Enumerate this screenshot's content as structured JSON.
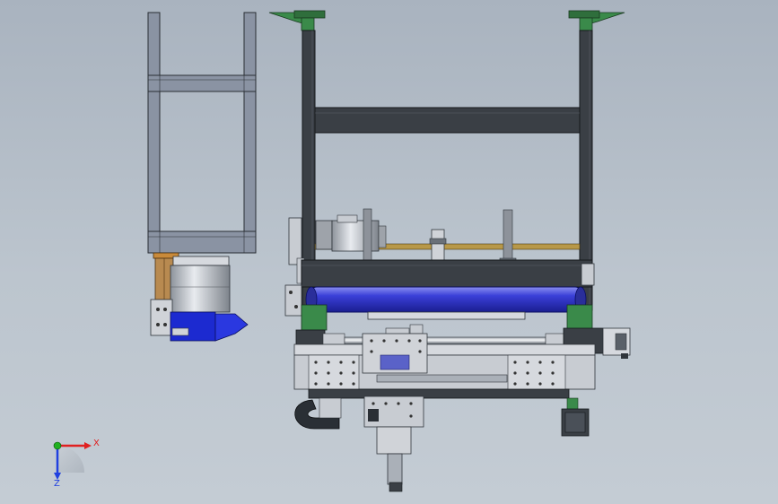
{
  "viewport": {
    "background_top": "#a9b3bf",
    "background_bottom": "#c4ccd4"
  },
  "triad": {
    "x_label": "X",
    "z_label": "Z",
    "x_color": "#e02020",
    "y_color": "#20b020",
    "z_color": "#2040e0"
  },
  "colors": {
    "frame_dark": "#3a3f45",
    "frame_light": "#8a93a3",
    "metal": "#c8ccd2",
    "roller_blue": "#3a3fd8",
    "motor_blue": "#1c2ad0",
    "bracket_green": "#3a8a4a",
    "wood": "#c98a3a"
  }
}
